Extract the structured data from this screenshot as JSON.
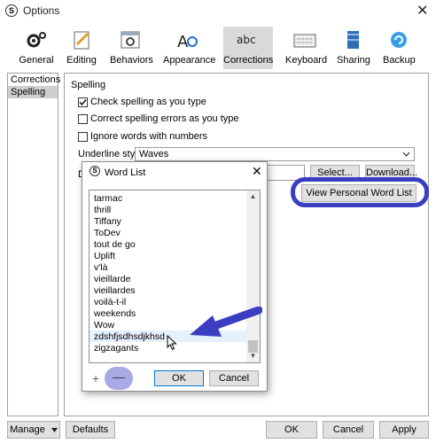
{
  "window": {
    "title": "Options",
    "close": "✕"
  },
  "toolbar": {
    "items": [
      {
        "label": "General"
      },
      {
        "label": "Editing"
      },
      {
        "label": "Behaviors"
      },
      {
        "label": "Appearance"
      },
      {
        "label": "Corrections"
      },
      {
        "label": "Keyboard"
      },
      {
        "label": "Sharing"
      },
      {
        "label": "Backup"
      }
    ],
    "selected": "Corrections"
  },
  "sidebar": {
    "items": [
      {
        "label": "Corrections"
      },
      {
        "label": "Spelling"
      }
    ],
    "selected": "Spelling"
  },
  "spelling": {
    "group_label": "Spelling",
    "check_spelling": {
      "label": "Check spelling as you type",
      "checked": true
    },
    "correct_errors": {
      "label": "Correct spelling errors as you type",
      "checked": false
    },
    "ignore_numbers": {
      "label": "Ignore words with numbers",
      "checked": false
    },
    "underline_label": "Underline style:",
    "underline_value": "Waves",
    "dictionary_label_partial": "D",
    "select_button": "Select...",
    "download_button": "Download...",
    "view_personal_button": "View Personal Word List"
  },
  "footer": {
    "manage": "Manage",
    "defaults": "Defaults",
    "ok": "OK",
    "cancel": "Cancel",
    "apply": "Apply"
  },
  "word_list_dialog": {
    "title": "Word List",
    "close": "✕",
    "words": [
      "tarmac",
      "thrill",
      "Tiffany",
      "ToDev",
      "tout de go",
      "Uplift",
      "v'là",
      "vieillarde",
      "vieillardes",
      "voilà-t-il",
      "weekends",
      "Wow",
      "zdshfjsdhsdjkhsd",
      "zigzagants"
    ],
    "selected_word": "zdshfjsdhsdjkhsd",
    "add": "+",
    "remove": "—",
    "ok": "OK",
    "cancel": "Cancel"
  },
  "colors": {
    "highlight": "#3b3ec0",
    "selected_toolbar": "#d9d9d9",
    "selected_row": "#e5f1fb"
  }
}
